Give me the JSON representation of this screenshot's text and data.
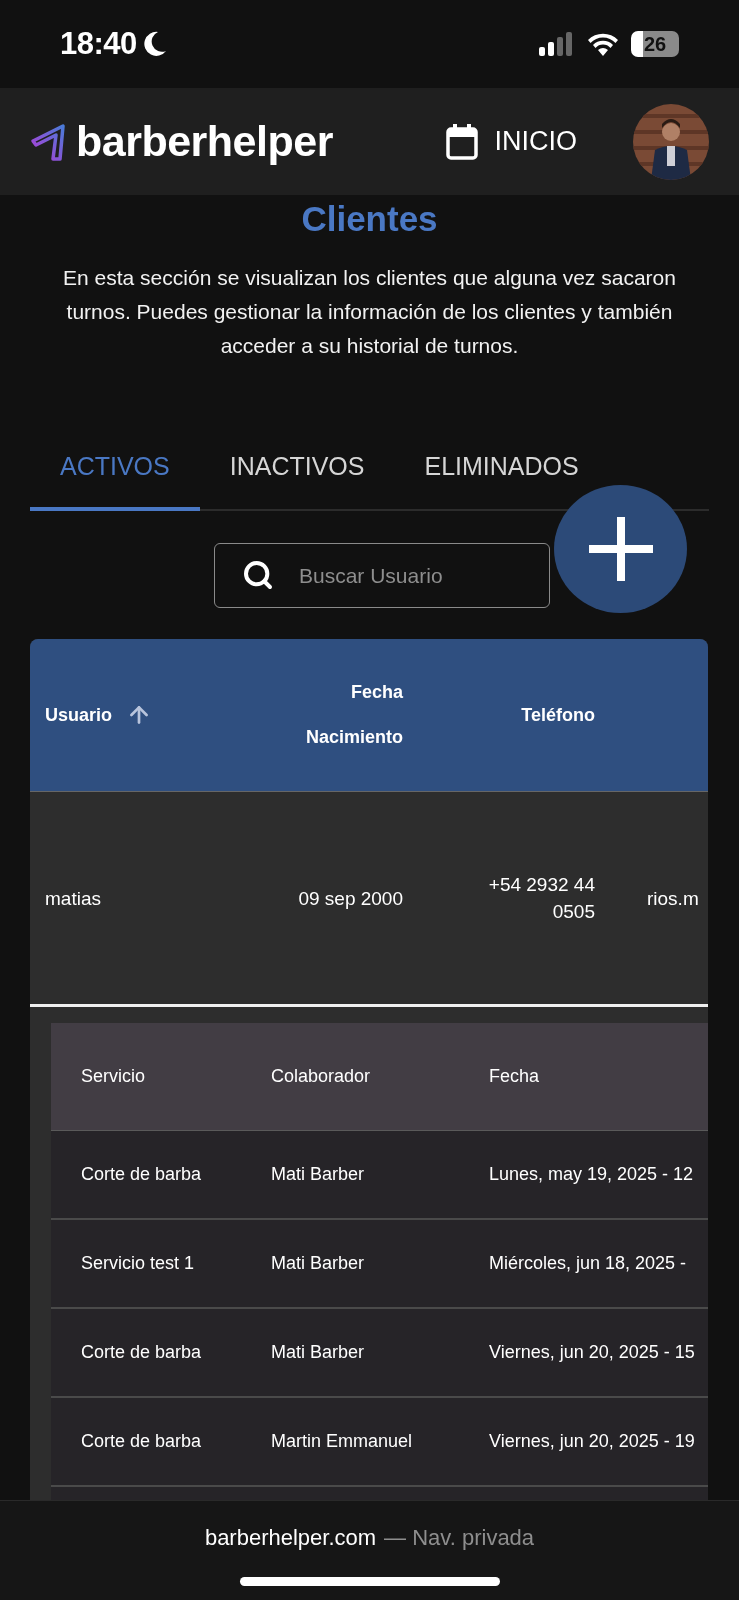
{
  "status_bar": {
    "time": "18:40",
    "battery": "26"
  },
  "header": {
    "brand": "barberhelper",
    "nav_link": "INICIO"
  },
  "page": {
    "title": "Clientes",
    "description": "En esta sección se visualizan los clientes que alguna vez sacaron turnos. Puedes gestionar la información de los clientes y también acceder a su historial de turnos."
  },
  "tabs": [
    {
      "label": "ACTIVOS",
      "selected": true
    },
    {
      "label": "INACTIVOS",
      "selected": false
    },
    {
      "label": "ELIMINADOS",
      "selected": false
    }
  ],
  "search": {
    "placeholder": "Buscar Usuario"
  },
  "clients_table": {
    "columns": [
      {
        "label": "Usuario",
        "sorted": true
      },
      {
        "label": "Fecha Nacimiento",
        "sorted": false
      },
      {
        "label": "Teléfono",
        "sorted": false
      }
    ],
    "rows": [
      {
        "cells": [
          "matias",
          "09 sep 2000",
          "+54 2932 44 0505",
          "rios.m"
        ],
        "expanded": true,
        "history": {
          "columns": [
            "Servicio",
            "Colaborador",
            "Fecha"
          ],
          "rows": [
            [
              "Corte de barba",
              "Mati Barber",
              "Lunes, may 19, 2025 - 12"
            ],
            [
              "Servicio test 1",
              "Mati Barber",
              "Miércoles, jun 18, 2025 -"
            ],
            [
              "Corte de barba",
              "Mati Barber",
              "Viernes, jun 20, 2025 - 15"
            ],
            [
              "Corte de barba",
              "Martin Emmanuel",
              "Viernes, jun 20, 2025 - 19"
            ]
          ]
        }
      }
    ]
  },
  "browser_bar": {
    "url": "barberhelper.com",
    "mode": "— Nav. privada"
  }
}
